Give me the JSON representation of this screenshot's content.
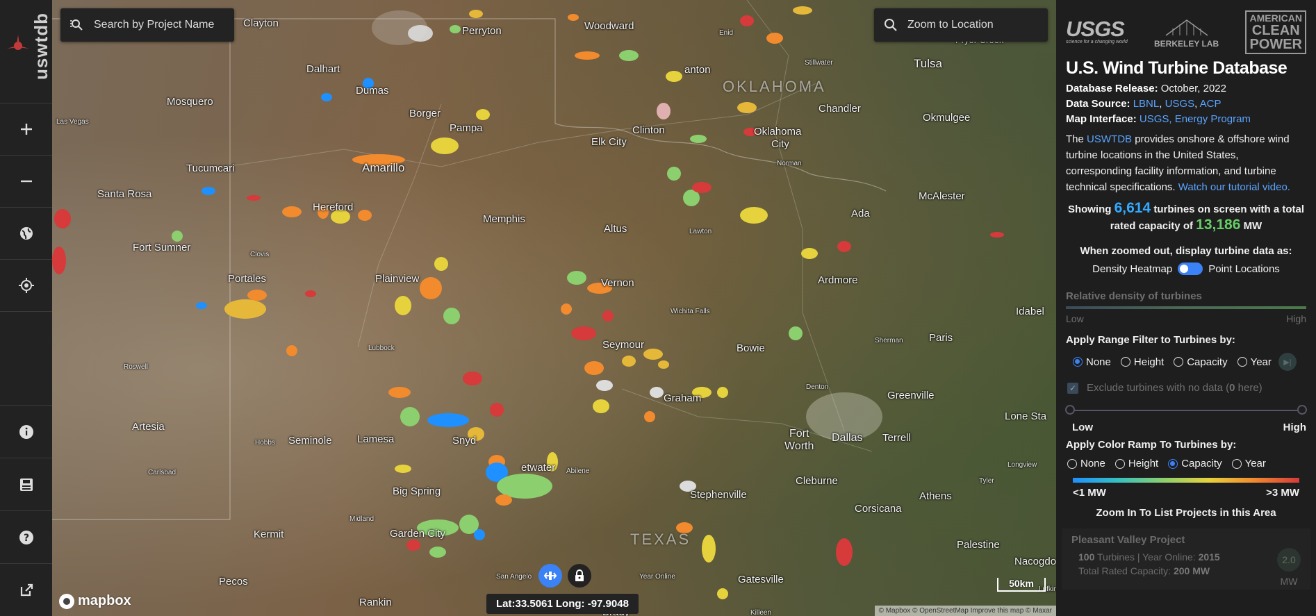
{
  "toolbar": {
    "brand": "uswtdb",
    "tools": [
      "zoom-in",
      "zoom-out",
      "basemap",
      "locate"
    ],
    "bottom_tools": [
      "info",
      "save",
      "help",
      "external-link"
    ]
  },
  "map": {
    "search": {
      "placeholder": "Search by Project Name"
    },
    "zoom_to": {
      "placeholder": "Zoom to Location"
    },
    "states": [
      "OKLAHOMA",
      "TEXAS"
    ],
    "places": {
      "clayton": "Clayton",
      "perryton": "Perryton",
      "woodward": "Woodward",
      "enid": "Enid",
      "pryor_creek": "Pryor Creek",
      "tulsa": "Tulsa",
      "stillwater": "Stillwater",
      "las_vegas": "Las Vegas",
      "mosquero": "Mosquero",
      "dalhart": "Dalhart",
      "dumas": "Dumas",
      "borger": "Borger",
      "pampa": "Pampa",
      "anton": "anton",
      "chandler": "Chandler",
      "okmulgee": "Okmulgee",
      "clinton": "Clinton",
      "oklahoma_city_1": "Oklahoma",
      "oklahoma_city_2": "City",
      "elk_city": "Elk City",
      "norman": "Norman",
      "tucumcari": "Tucumcari",
      "amarillo": "Amarillo",
      "santa_rosa": "Santa Rosa",
      "hereford": "Hereford",
      "memphis": "Memphis",
      "altus": "Altus",
      "lawton": "Lawton",
      "mcalester": "McAlester",
      "ada": "Ada",
      "fort_sumner": "Fort Sumner",
      "clovis": "Clovis",
      "portales": "Portales",
      "plainview": "Plainview",
      "vernon": "Vernon",
      "ardmore": "Ardmore",
      "wichita_falls": "Wichita Falls",
      "idabel": "Idabel",
      "lubbock": "Lubbock",
      "seymour": "Seymour",
      "bowie": "Bowie",
      "paris": "Paris",
      "sherman": "Sherman",
      "roswell": "Roswell",
      "denton": "Denton",
      "greenville": "Greenville",
      "graham": "Graham",
      "artesia": "Artesia",
      "hobbs": "Hobbs",
      "seminole": "Seminole",
      "lamesa": "Lamesa",
      "snyder": "Snyd",
      "fort_worth_1": "Fort",
      "fort_worth_2": "Worth",
      "dallas": "Dallas",
      "terrell": "Terrell",
      "lone_star": "Lone Sta",
      "sweetwater": "etwater",
      "abilene": "Abilene",
      "carlsbad": "Carlsbad",
      "longview": "Longview",
      "tyler": "Tyler",
      "big_spring": "Big Spring",
      "stephenville": "Stephenville",
      "cleburne": "Cleburne",
      "athens": "Athens",
      "midland": "Midland",
      "kermit": "Kermit",
      "garden_city": "Garden City",
      "corsicana": "Corsicana",
      "palestine": "Palestine",
      "nacogdoches": "Nacogdo",
      "san_angelo": "San Angelo",
      "year_online": "Year Online",
      "pecos": "Pecos",
      "gatesville": "Gatesville",
      "lufkin": "Lufkin",
      "rankin": "Rankin",
      "brady": "Brady",
      "killeen": "Killeen"
    },
    "scale": "50km",
    "attribution": "© Mapbox © OpenStreetMap Improve this map © Maxar",
    "logo": "mapbox",
    "coords": "Lat:33.5061  Long: -97.9048"
  },
  "panel": {
    "logos": {
      "usgs": "USGS",
      "usgs_tag": "science for a changing world",
      "lbl": "BERKELEY LAB",
      "acp_1": "AMERICAN",
      "acp_2": "CLEAN",
      "acp_3": "POWER"
    },
    "title": "U.S. Wind Turbine Database",
    "release_label": "Database Release:",
    "release_value": "October, 2022",
    "source_label": "Data Source:",
    "source_lbnl": "LBNL",
    "source_usgs": "USGS",
    "source_acp": "ACP",
    "interface_label": "Map Interface:",
    "interface_value": "USGS, Energy Program",
    "desc_pre": "The",
    "desc_link": "USWTDB",
    "desc_body": "provides onshore & offshore wind turbine locations in the United States, corresponding facility information, and turbine technical specifications.",
    "desc_video": "Watch our tutorial video.",
    "showing_1": "Showing",
    "turbine_count": "6,614",
    "showing_2": "turbines on screen with a total rated capacity of",
    "capacity": "13,186",
    "capacity_unit": "MW",
    "zoomed_out_label": "When zoomed out, display turbine data as:",
    "toggle_left": "Density Heatmap",
    "toggle_right": "Point Locations",
    "density_label": "Relative density of turbines",
    "density_low": "Low",
    "density_high": "High",
    "range_label": "Apply Range Filter to Turbines by:",
    "range_options": [
      "None",
      "Height",
      "Capacity",
      "Year"
    ],
    "range_selected": "None",
    "exclude_label_pre": "Exclude turbines with no data (",
    "exclude_count": "0",
    "exclude_label_post": " here)",
    "slider_low": "Low",
    "slider_high": "High",
    "ramp_label": "Apply Color Ramp To Turbines by:",
    "ramp_options": [
      "None",
      "Height",
      "Capacity",
      "Year"
    ],
    "ramp_selected": "Capacity",
    "ramp_low": "<1 MW",
    "ramp_high": ">3 MW",
    "zoom_list": "Zoom In To List Projects in this Area",
    "project": {
      "name": "Pleasant Valley Project",
      "turbines": "100",
      "turbines_label": "Turbines |",
      "year_label": "Year Online:",
      "year": "2015",
      "capacity_label": "Total Rated Capacity:",
      "capacity": "200 MW",
      "mw_value": "2.0",
      "mw_unit": "MW"
    }
  },
  "colors": {
    "accent": "#3b82f6",
    "link": "#5aa4ff",
    "count": "#33aaff",
    "capacity": "#66cc66"
  }
}
